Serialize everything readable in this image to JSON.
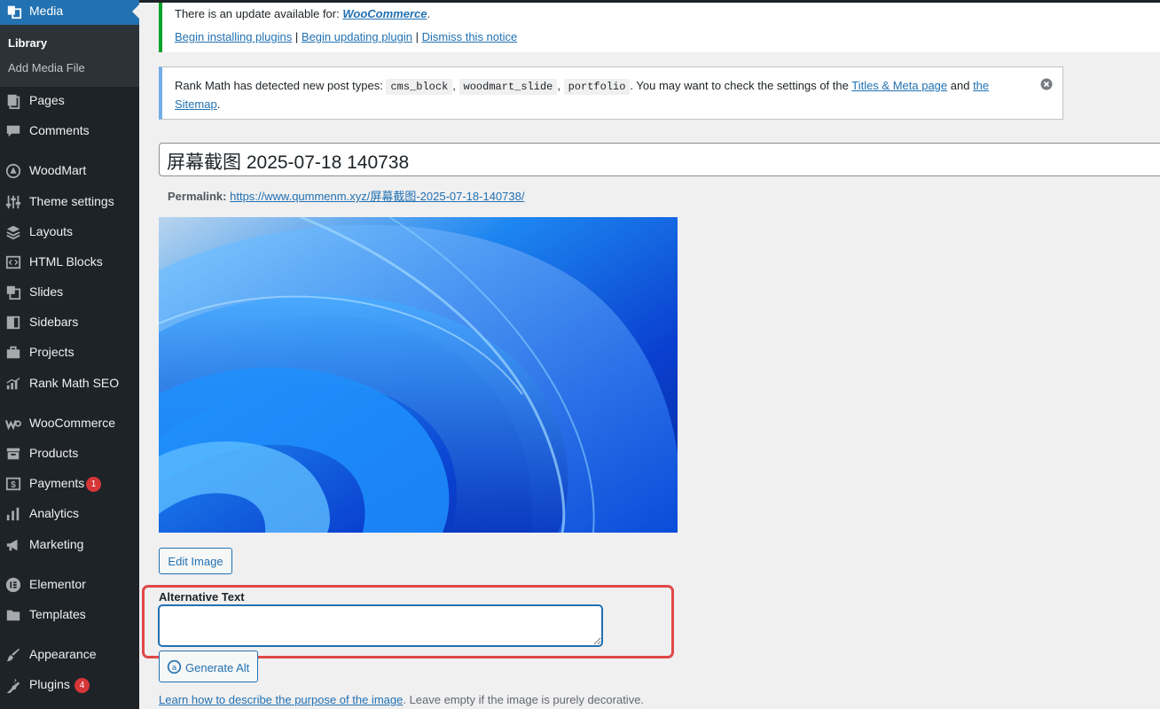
{
  "sidebar": {
    "current": {
      "label": "Media",
      "icon": "media-icon"
    },
    "submenu": [
      {
        "label": "Library",
        "active": true
      },
      {
        "label": "Add Media File",
        "active": false
      }
    ],
    "items": [
      {
        "label": "Pages",
        "icon": "pages-icon"
      },
      {
        "label": "Comments",
        "icon": "comments-icon"
      },
      {
        "label": "WoodMart",
        "icon": "woodmart-icon"
      },
      {
        "label": "Theme settings",
        "icon": "sliders-icon"
      },
      {
        "label": "Layouts",
        "icon": "layers-icon"
      },
      {
        "label": "HTML Blocks",
        "icon": "code-icon"
      },
      {
        "label": "Slides",
        "icon": "slides-icon"
      },
      {
        "label": "Sidebars",
        "icon": "sidebar-icon"
      },
      {
        "label": "Projects",
        "icon": "briefcase-icon"
      },
      {
        "label": "Rank Math SEO",
        "icon": "rankmath-icon"
      },
      {
        "label": "WooCommerce",
        "icon": "woocommerce-icon"
      },
      {
        "label": "Products",
        "icon": "archive-icon"
      },
      {
        "label": "Payments",
        "icon": "payments-icon",
        "badge": "1"
      },
      {
        "label": "Analytics",
        "icon": "chart-icon"
      },
      {
        "label": "Marketing",
        "icon": "megaphone-icon"
      },
      {
        "label": "Elementor",
        "icon": "elementor-icon"
      },
      {
        "label": "Templates",
        "icon": "folder-icon"
      },
      {
        "label": "Appearance",
        "icon": "brush-icon"
      },
      {
        "label": "Plugins",
        "icon": "plugin-icon",
        "badge": "4"
      }
    ]
  },
  "update_notice": {
    "text": "There is an update available for: ",
    "plugin_link": "WooCommerce",
    "period": ".",
    "links": [
      "Begin installing plugins",
      "Begin updating plugin",
      "Dismiss this notice"
    ],
    "separator": "|"
  },
  "rankmath_notice": {
    "text_before": "Rank Math has detected new post types: ",
    "post_types": [
      "cms_block",
      "woodmart_slide",
      "portfolio"
    ],
    "comma": ",",
    "text_middle": ". You may want to check the settings of the ",
    "link1": "Titles & Meta page",
    "and": " and ",
    "link2_a": "the",
    "link2_b": "Sitemap",
    "period": "."
  },
  "post": {
    "title": "屏幕截图 2025-07-18 140738",
    "permalink_label": "Permalink:",
    "permalink_url": "https://www.qummenm.xyz/屏幕截图-2025-07-18-140738/"
  },
  "edit_image_label": "Edit Image",
  "alt_text": {
    "label": "Alternative Text",
    "value": "",
    "generate_label": "Generate Alt",
    "help_link": "Learn how to describe the purpose of the image",
    "help_text": ". Leave empty if the image is purely decorative."
  },
  "colors": {
    "sidebar_bg": "#1d2327",
    "accent": "#2271b1",
    "badge": "#d63638",
    "highlight": "#e04848"
  }
}
